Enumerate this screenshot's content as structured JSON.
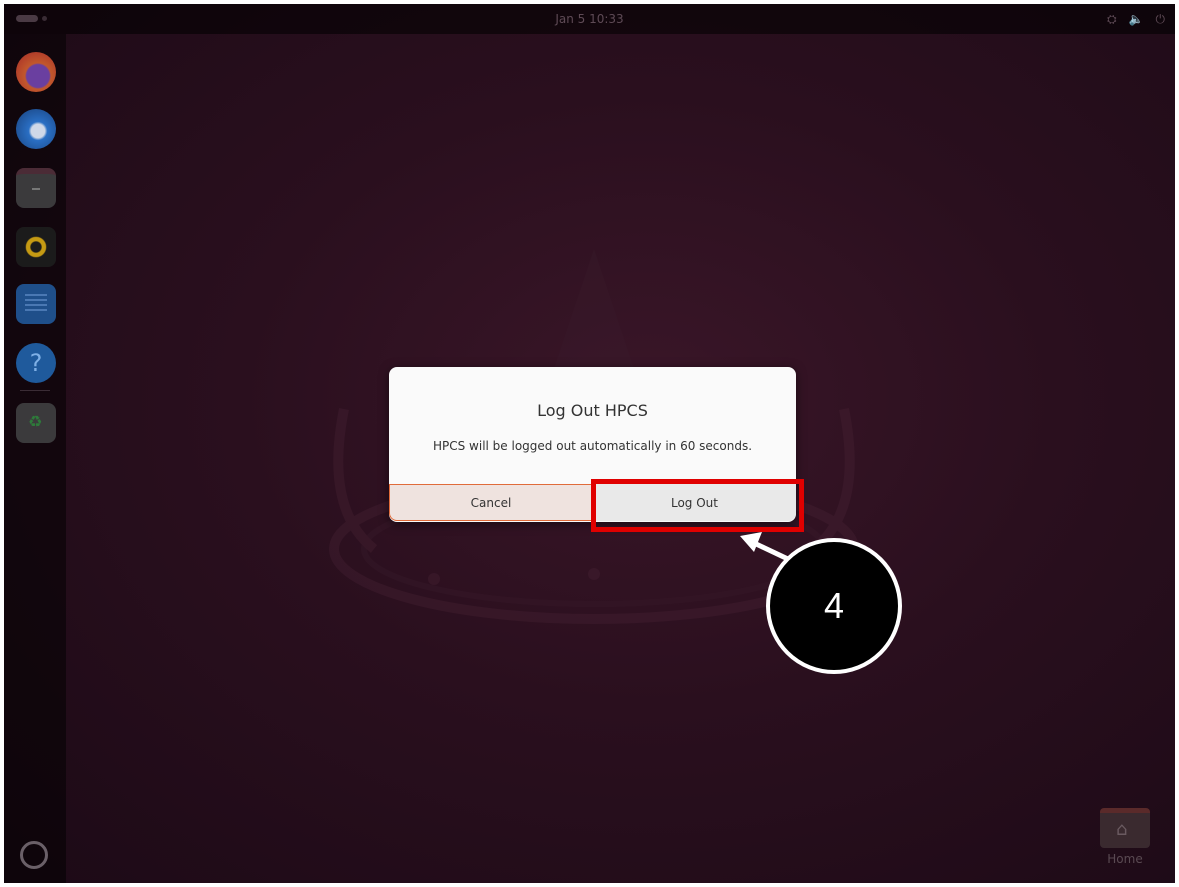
{
  "topbar": {
    "clock": "Jan 5  10:33",
    "icons": [
      "network-icon",
      "volume-icon",
      "power-icon"
    ]
  },
  "dock": {
    "items": [
      {
        "name": "firefox"
      },
      {
        "name": "thunderbird"
      },
      {
        "name": "files"
      },
      {
        "name": "rhythmbox"
      },
      {
        "name": "libreoffice-writer"
      },
      {
        "name": "help",
        "glyph": "?"
      },
      {
        "name": "trash"
      }
    ]
  },
  "dialog": {
    "title": "Log Out HPCS",
    "message": "HPCS will be logged out automatically in 60 seconds.",
    "cancel_label": "Cancel",
    "logout_label": "Log Out"
  },
  "annotation": {
    "step_number": "4",
    "highlight_color": "#e00000"
  },
  "desktop": {
    "home_label": "Home"
  }
}
